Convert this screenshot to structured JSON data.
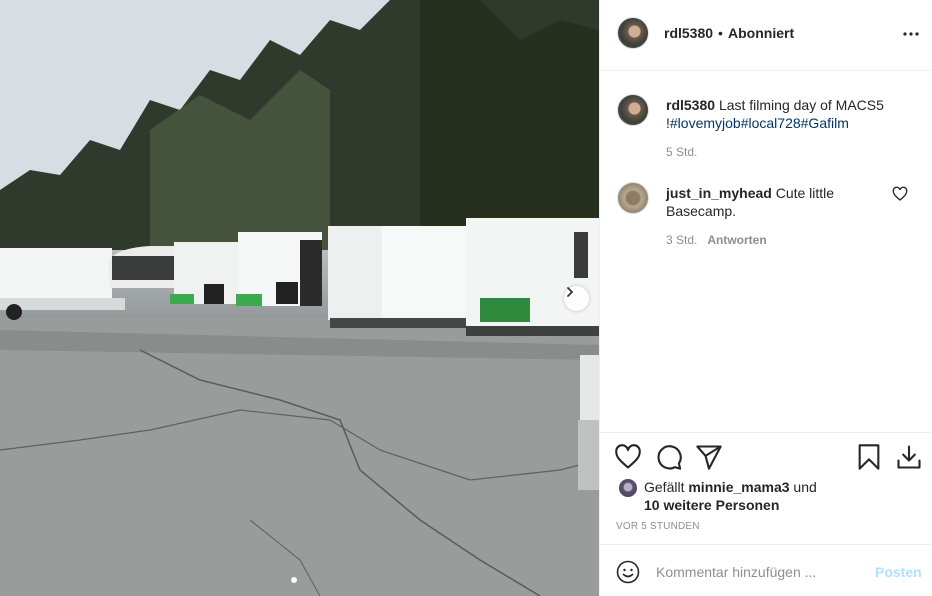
{
  "post": {
    "author": "rdl5380",
    "separator": "•",
    "follow_status": "Abonniert"
  },
  "caption": {
    "username": "rdl5380",
    "text": "Last filming day of MACS5 !",
    "hashtags": "#lovemyjob#local728#Gafilm",
    "time": "5 Std."
  },
  "comments": [
    {
      "username": "just_in_myhead",
      "text": "Cute little Basecamp.",
      "time": "3 Std.",
      "reply_label": "Antworten"
    }
  ],
  "likes": {
    "prefix": "Gefällt",
    "user": "minnie_mama3",
    "middle": "und",
    "others": "10 weitere Personen"
  },
  "timestamp": "VOR 5 STUNDEN",
  "comment_box": {
    "placeholder": "Kommentar hinzufügen ...",
    "post_label": "Posten"
  },
  "icons": {
    "more": "more-horizontal-icon",
    "like": "heart-icon",
    "comment": "comment-bubble-icon",
    "share": "paper-plane-icon",
    "save": "bookmark-icon",
    "download": "download-icon",
    "emoji": "smiley-icon",
    "next": "chevron-right-icon"
  },
  "colors": {
    "hashtag": "#00376b",
    "meta_gray": "#8e8e8e",
    "post_button_disabled": "#b2dffc",
    "border": "#efefef"
  }
}
